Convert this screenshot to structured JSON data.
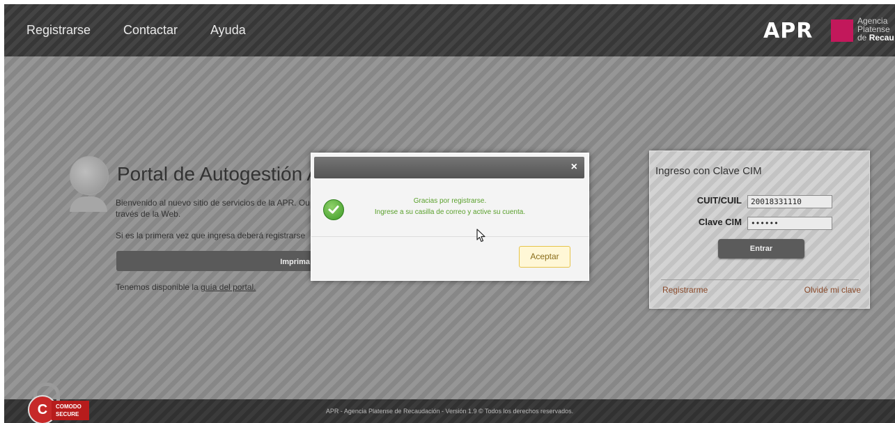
{
  "nav": {
    "items": [
      "Registrarse",
      "Contactar",
      "Ayuda"
    ]
  },
  "logo": {
    "abbr": "APR",
    "line1": "Agencia",
    "line2": "Platense",
    "line3_prefix": "de ",
    "line3_bold": "Recau",
    "brand_color": "#c2185b"
  },
  "portal": {
    "title": "Portal de Autogestión AP",
    "intro": "Bienvenido al nuevo sitio de servicios de la APR. Ou través de la Web.",
    "first_time": "Si es la primera vez que ingresa deberá registrarse",
    "print_button": "Imprima",
    "guide_prefix": "Tenemos disponible la ",
    "guide_link": "guía del portal."
  },
  "login": {
    "title": "Ingreso con Clave CIM",
    "cuit_label": "CUIT/CUIL",
    "cuit_value": "20018331110",
    "clave_label": "Clave CIM",
    "clave_value": "••••••",
    "enter_button": "Entrar",
    "register_link": "Registrarme",
    "forgot_link": "Olvidé mi clave"
  },
  "modal": {
    "close": "×",
    "message_line1": "Gracias por registrarse.",
    "message_line2": "Ingrese a su casilla de correo y active su cuenta.",
    "accept_button": "Aceptar",
    "icon": "check-icon"
  },
  "footer": {
    "text": "APR - Agencia Platense de Recaudación - Versión 1.9 © Todos los derechos reservados."
  },
  "badge": {
    "line1": "COMODO",
    "line2": "SECURE",
    "letter": "C"
  }
}
